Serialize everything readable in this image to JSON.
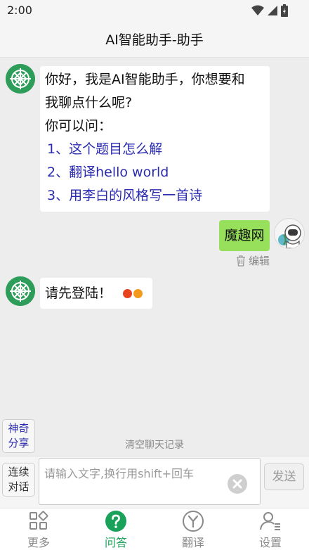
{
  "status": {
    "time": "2:00"
  },
  "header": {
    "title": "AI智能助手-助手"
  },
  "messages": {
    "bot_greeting": {
      "line1": "你好，我是AI智能助手，你想要和",
      "line2": "我聊点什么呢?",
      "line3": "你可以问：",
      "suggestions": [
        "1、这个题目怎么解",
        "2、翻译hello world",
        "3、用李白的风格写一首诗"
      ]
    },
    "user_message": {
      "text": "魔趣网",
      "edit_label": "编辑"
    },
    "bot_reply": {
      "text": "请先登陆！"
    }
  },
  "side_actions": {
    "magic_share_line1": "神奇",
    "magic_share_line2": "分享"
  },
  "clear_history": "清空聊天记录",
  "input": {
    "continuous_line1": "连续",
    "continuous_line2": "对话",
    "placeholder": "请输入文字,换行用shift+回车",
    "send_label": "发送"
  },
  "tabs": [
    {
      "label": "更多",
      "icon": "grid-icon"
    },
    {
      "label": "问答",
      "icon": "question-icon",
      "active": true
    },
    {
      "label": "翻译",
      "icon": "translate-icon"
    },
    {
      "label": "设置",
      "icon": "user-settings-icon"
    }
  ],
  "colors": {
    "accent": "#1aa15a",
    "user_bubble": "#96e05c",
    "link": "#2a2ab0",
    "bot_avatar": "#2e9d59",
    "typing_dot_1": "#e8421f",
    "typing_dot_2": "#f39a1c"
  }
}
